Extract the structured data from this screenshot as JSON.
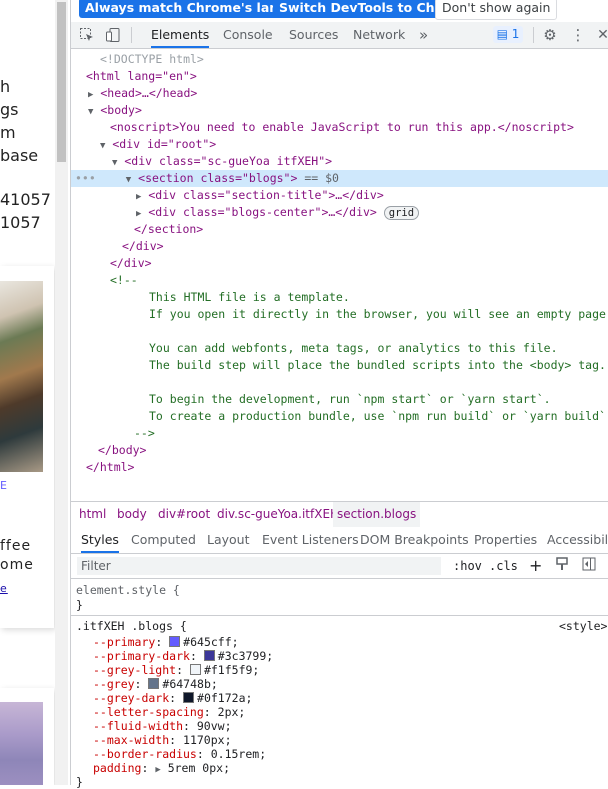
{
  "page": {
    "text_lines": [
      "h",
      "gs",
      "m",
      "base",
      "41057",
      "1057"
    ],
    "card_text": [
      "E",
      "ffee",
      "ome"
    ],
    "link_text": "e"
  },
  "infobar": {
    "btn_match": "Always match Chrome's language",
    "btn_switch": "Switch DevTools to Chinese",
    "btn_dismiss": "Don't show again"
  },
  "toolbar": {
    "tabs": [
      "Elements",
      "Console",
      "Sources",
      "Network"
    ],
    "more": "»",
    "issues_count": "1",
    "icons": {
      "inspect": "inspect-icon",
      "device": "device-toggle-icon",
      "settings": "gear-icon",
      "menu": "kebab-menu-icon",
      "close": "close-icon"
    }
  },
  "dom": {
    "doctype": "<!DOCTYPE html>",
    "html_open": "<html lang=\"en\">",
    "head": "<head>…</head>",
    "body_open": "<body>",
    "noscript": "<noscript>You need to enable JavaScript to run this app.</noscript>",
    "root_open": "<div id=\"root\">",
    "sc_open": "<div class=\"sc-gueYoa itfXEH\">",
    "section_open": "<section class=\"blogs\">",
    "selected_marker": "== $0",
    "ellipsis": "•••",
    "section_title": "<div class=\"section-title\">…</div>",
    "blogs_center": "<div class=\"blogs-center\">…</div>",
    "grid_badge": "grid",
    "section_close": "</section>",
    "div_close_1": "</div>",
    "div_close_2": "</div>",
    "comment_open": "<!--",
    "comment_lines": [
      "This HTML file is a template.",
      "If you open it directly in the browser, you will see an empty page.",
      "",
      "You can add webfonts, meta tags, or analytics to this file.",
      "The build step will place the bundled scripts into the <body> tag.",
      "",
      "To begin the development, run `npm start` or `yarn start`.",
      "To create a production bundle, use `npm run build` or `yarn build`."
    ],
    "comment_close": "-->",
    "body_close": "</body>",
    "html_close": "</html>"
  },
  "breadcrumbs": [
    "html",
    "body",
    "div#root",
    "div.sc-gueYoa.itfXEH",
    "section.blogs"
  ],
  "subtabs": [
    "Styles",
    "Computed",
    "Layout",
    "Event Listeners",
    "DOM Breakpoints",
    "Properties",
    "Accessibility"
  ],
  "filter": {
    "placeholder": "Filter",
    "hov": ":hov",
    "cls": ".cls",
    "plus": "+"
  },
  "styles": {
    "element_style": "element.style {",
    "close_brace": "}",
    "rule_selector": ".itfXEH .blogs {",
    "rule_source": "<style>",
    "props": [
      {
        "name": "--primary",
        "value": "#645cff",
        "swatch": "#645cff"
      },
      {
        "name": "--primary-dark",
        "value": "#3c3799",
        "swatch": "#3c3799"
      },
      {
        "name": "--grey-light",
        "value": "#f1f5f9",
        "swatch": "#f1f5f9"
      },
      {
        "name": "--grey",
        "value": "#64748b",
        "swatch": "#64748b"
      },
      {
        "name": "--grey-dark",
        "value": "#0f172a",
        "swatch": "#0f172a"
      },
      {
        "name": "--letter-spacing",
        "value": "2px"
      },
      {
        "name": "--fluid-width",
        "value": "90vw"
      },
      {
        "name": "--max-width",
        "value": "1170px"
      },
      {
        "name": "--border-radius",
        "value": "0.15rem"
      },
      {
        "name": "padding",
        "value": "5rem 0px",
        "expandable": true
      }
    ]
  }
}
